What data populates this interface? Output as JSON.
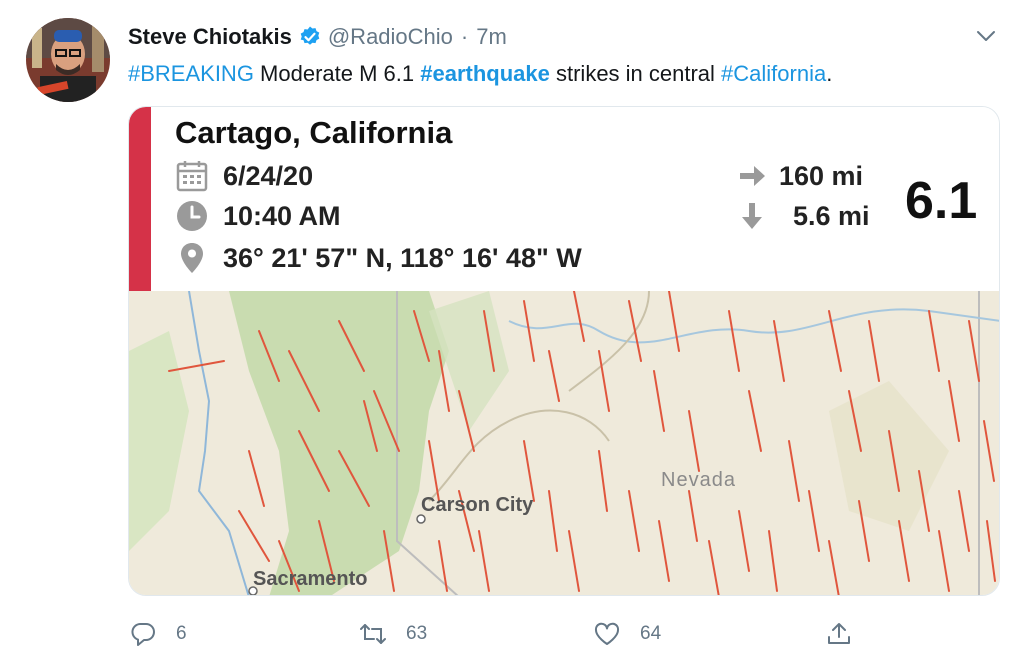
{
  "tweet": {
    "author_name": "Steve Chiotakis",
    "handle": "@RadioChio",
    "separator": "·",
    "timestamp": "7m",
    "text": [
      {
        "t": "#BREAKING",
        "kind": "link"
      },
      {
        "t": " Moderate M 6.1 ",
        "kind": "plain"
      },
      {
        "t": "#earthquake",
        "kind": "boldlink"
      },
      {
        "t": " strikes in central ",
        "kind": "plain"
      },
      {
        "t": "#California",
        "kind": "link"
      },
      {
        "t": ".",
        "kind": "plain"
      }
    ]
  },
  "card": {
    "location": "Cartago, California",
    "date": "6/24/20",
    "time": "10:40 AM",
    "coordinates": "36° 21' 57\" N, 118° 16' 48\" W",
    "distance": "160 mi",
    "depth": "5.6 mi",
    "magnitude": "6.1",
    "accent_color": "#d53248",
    "map_labels": {
      "city1": "Carson City",
      "city2": "Sacramento",
      "state": "Nevada"
    }
  },
  "actions": {
    "reply_count": "6",
    "retweet_count": "63",
    "like_count": "64"
  },
  "colors": {
    "link": "#1b95e0",
    "muted": "#657786",
    "fault_line": "#e0563d",
    "map_green": "#c9dcb0",
    "map_sand": "#efeadb"
  },
  "icons": [
    "verified-badge-icon",
    "chevron-down-icon",
    "calendar-icon",
    "clock-icon",
    "map-pin-icon",
    "arrow-right-icon",
    "arrow-down-icon",
    "reply-icon",
    "retweet-icon",
    "like-icon",
    "share-icon"
  ]
}
